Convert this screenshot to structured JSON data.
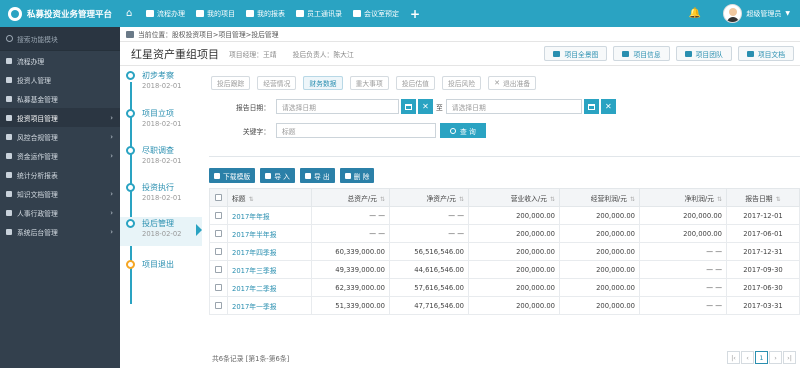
{
  "app": {
    "title": "私募投资业务管理平台",
    "nav": [
      "流程办理",
      "我的项目",
      "我的报表",
      "员工通讯录",
      "会议室预定"
    ],
    "user": "超级管理员"
  },
  "sidebar": {
    "search_placeholder": "搜索功能模块",
    "items": [
      {
        "label": "流程办理",
        "icon": "flow-icon",
        "expandable": false
      },
      {
        "label": "投资人管理",
        "icon": "user-icon",
        "expandable": false
      },
      {
        "label": "私募基金管理",
        "icon": "fund-icon",
        "expandable": false
      },
      {
        "label": "投资项目管理",
        "icon": "briefcase-icon",
        "expandable": true
      },
      {
        "label": "风控合规管理",
        "icon": "rocket-icon",
        "expandable": true
      },
      {
        "label": "资金运作管理",
        "icon": "yen-icon",
        "expandable": true
      },
      {
        "label": "统计分析报表",
        "icon": "chart-icon",
        "expandable": false
      },
      {
        "label": "知识文档管理",
        "icon": "folder-icon",
        "expandable": true
      },
      {
        "label": "人事行政管理",
        "icon": "person-icon",
        "expandable": true
      },
      {
        "label": "系统后台管理",
        "icon": "monitor-icon",
        "expandable": true
      }
    ]
  },
  "breadcrumb": "当前位置：股权投资项目>项目管理>投后管理",
  "project": {
    "title": "红星资产重组项目",
    "manager": "项目经理：王靖",
    "post_manager": "投后负责人：陈大江",
    "buttons": [
      "项目全景图",
      "项目信息",
      "项目团队",
      "项目文档"
    ]
  },
  "timeline": [
    {
      "name": "初步考察",
      "date": "2018-02-01"
    },
    {
      "name": "项目立项",
      "date": "2018-02-01"
    },
    {
      "name": "尽职调查",
      "date": "2018-02-01"
    },
    {
      "name": "投资执行",
      "date": "2018-02-01"
    },
    {
      "name": "投后管理",
      "date": "2018-02-02"
    },
    {
      "name": "项目退出",
      "date": ""
    }
  ],
  "tabs": [
    "投后跟踪",
    "经营情况",
    "财务数据",
    "重大事项",
    "投后估值",
    "投后风险",
    "退出准备"
  ],
  "filters": {
    "date_label": "报告日期：",
    "date_from_placeholder": "请选择日期",
    "to": "至",
    "date_to_placeholder": "请选择日期",
    "keyword_label": "关键字：",
    "keyword_placeholder": "标题",
    "search": "查 询"
  },
  "actions": [
    "下载模版",
    "导 入",
    "导 出",
    "删 除"
  ],
  "table": {
    "headers": [
      "标题",
      "总资产/元",
      "净资产/元",
      "营业收入/元",
      "经营利润/元",
      "净利润/元",
      "报告日期"
    ],
    "rows": [
      [
        "2017年年报",
        "— —",
        "— —",
        "200,000.00",
        "200,000.00",
        "200,000.00",
        "2017-12-01"
      ],
      [
        "2017年半年报",
        "— —",
        "— —",
        "200,000.00",
        "200,000.00",
        "200,000.00",
        "2017-06-01"
      ],
      [
        "2017年四季报",
        "60,339,000.00",
        "56,516,546.00",
        "200,000.00",
        "200,000.00",
        "— —",
        "2017-12-31"
      ],
      [
        "2017年三季报",
        "49,339,000.00",
        "44,616,546.00",
        "200,000.00",
        "200,000.00",
        "— —",
        "2017-09-30"
      ],
      [
        "2017年二季报",
        "62,339,000.00",
        "57,616,546.00",
        "200,000.00",
        "200,000.00",
        "— —",
        "2017-06-30"
      ],
      [
        "2017年一季报",
        "51,339,000.00",
        "47,716,546.00",
        "200,000.00",
        "200,000.00",
        "— —",
        "2017-03-31"
      ]
    ]
  },
  "footer": {
    "summary": "共6条记录 [第1条-第6条]",
    "page": "1"
  }
}
